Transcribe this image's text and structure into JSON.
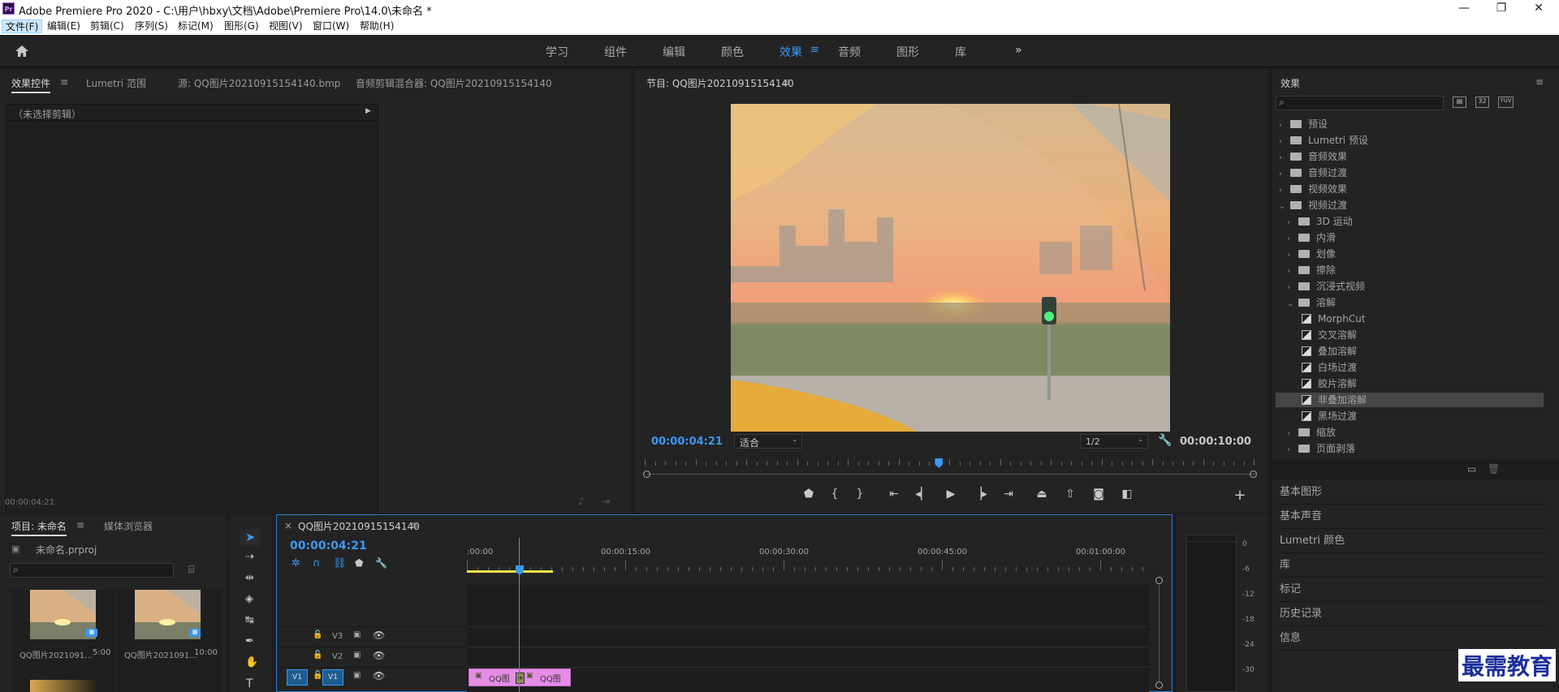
{
  "window": {
    "title": "Adobe Premiere Pro 2020 - C:\\用户\\hbxy\\文档\\Adobe\\Premiere Pro\\14.0\\未命名 *",
    "app_icon": "Pr"
  },
  "menus": [
    "文件(F)",
    "编辑(E)",
    "剪辑(C)",
    "序列(S)",
    "标记(M)",
    "图形(G)",
    "视图(V)",
    "窗口(W)",
    "帮助(H)"
  ],
  "workspaces": [
    "学习",
    "组件",
    "编辑",
    "颜色",
    "效果",
    "音频",
    "图形",
    "库"
  ],
  "active_workspace": "效果",
  "source_panel": {
    "tabs": [
      "效果控件",
      "Lumetri 范围",
      "源: QQ图片20210915154140.bmp",
      "音频剪辑混合器: QQ图片20210915154140"
    ],
    "no_clip": "（未选择剪辑）",
    "timecode": "00:00:04:21"
  },
  "program": {
    "title": "节目: QQ图片20210915154140",
    "timecode": "00:00:04:21",
    "fit": "适合",
    "resolution": "1/2",
    "duration": "00:00:10:00",
    "playhead_fraction": 0.48
  },
  "effects_panel": {
    "title": "效果",
    "search_placeholder": "",
    "items": [
      {
        "label": "预设",
        "level": 0,
        "type": "folder-star",
        "open": false
      },
      {
        "label": "Lumetri 预设",
        "level": 0,
        "type": "folder-star",
        "open": false
      },
      {
        "label": "音频效果",
        "level": 0,
        "type": "folder",
        "open": false
      },
      {
        "label": "音频过渡",
        "level": 0,
        "type": "folder",
        "open": false
      },
      {
        "label": "视频效果",
        "level": 0,
        "type": "folder",
        "open": false
      },
      {
        "label": "视频过渡",
        "level": 0,
        "type": "folder",
        "open": true
      },
      {
        "label": "3D 运动",
        "level": 1,
        "type": "folder",
        "open": false
      },
      {
        "label": "内滑",
        "level": 1,
        "type": "folder",
        "open": false
      },
      {
        "label": "划像",
        "level": 1,
        "type": "folder",
        "open": false
      },
      {
        "label": "擦除",
        "level": 1,
        "type": "folder",
        "open": false
      },
      {
        "label": "沉浸式视频",
        "level": 1,
        "type": "folder",
        "open": false
      },
      {
        "label": "溶解",
        "level": 1,
        "type": "folder",
        "open": true
      },
      {
        "label": "MorphCut",
        "level": 2,
        "type": "fx"
      },
      {
        "label": "交叉溶解",
        "level": 2,
        "type": "fx"
      },
      {
        "label": "叠加溶解",
        "level": 2,
        "type": "fx"
      },
      {
        "label": "白场过渡",
        "level": 2,
        "type": "fx"
      },
      {
        "label": "胶片溶解",
        "level": 2,
        "type": "fx"
      },
      {
        "label": "非叠加溶解",
        "level": 2,
        "type": "fx",
        "selected": true
      },
      {
        "label": "黑场过渡",
        "level": 2,
        "type": "fx"
      },
      {
        "label": "缩放",
        "level": 1,
        "type": "folder",
        "open": false
      },
      {
        "label": "页面剥落",
        "level": 1,
        "type": "folder",
        "open": false
      }
    ],
    "icon_labels": [
      "32",
      "YUV"
    ]
  },
  "side_sections": [
    "基本图形",
    "基本声音",
    "Lumetri 颜色",
    "库",
    "标记",
    "历史记录",
    "信息"
  ],
  "project": {
    "tabs": [
      "项目: 未命名",
      "媒体浏览器"
    ],
    "file": "未命名.prproj",
    "items": [
      {
        "name": "QQ图片2021091...",
        "duration": "5:00"
      },
      {
        "name": "QQ图片2021091...",
        "duration": "10:00"
      }
    ]
  },
  "timeline": {
    "tab": "QQ图片20210915154140",
    "timecode": "00:00:04:21",
    "ruler": [
      ":00:00",
      "00:00:15:00",
      "00:00:30:00",
      "00:00:45:00",
      "00:01:00:00"
    ],
    "tracks": [
      "V3",
      "V2",
      "V1"
    ],
    "source_patch": "V1",
    "clips": [
      "QQ图",
      "QQ图"
    ],
    "transition_mark": "≡"
  },
  "meter": {
    "labels": [
      "0",
      "-6",
      "-12",
      "-18",
      "-24",
      "-30"
    ]
  },
  "watermark": "最需教育",
  "colors": {
    "accent": "#3a98f5",
    "clip": "#e58de6",
    "work_area": "#f2e64b"
  }
}
